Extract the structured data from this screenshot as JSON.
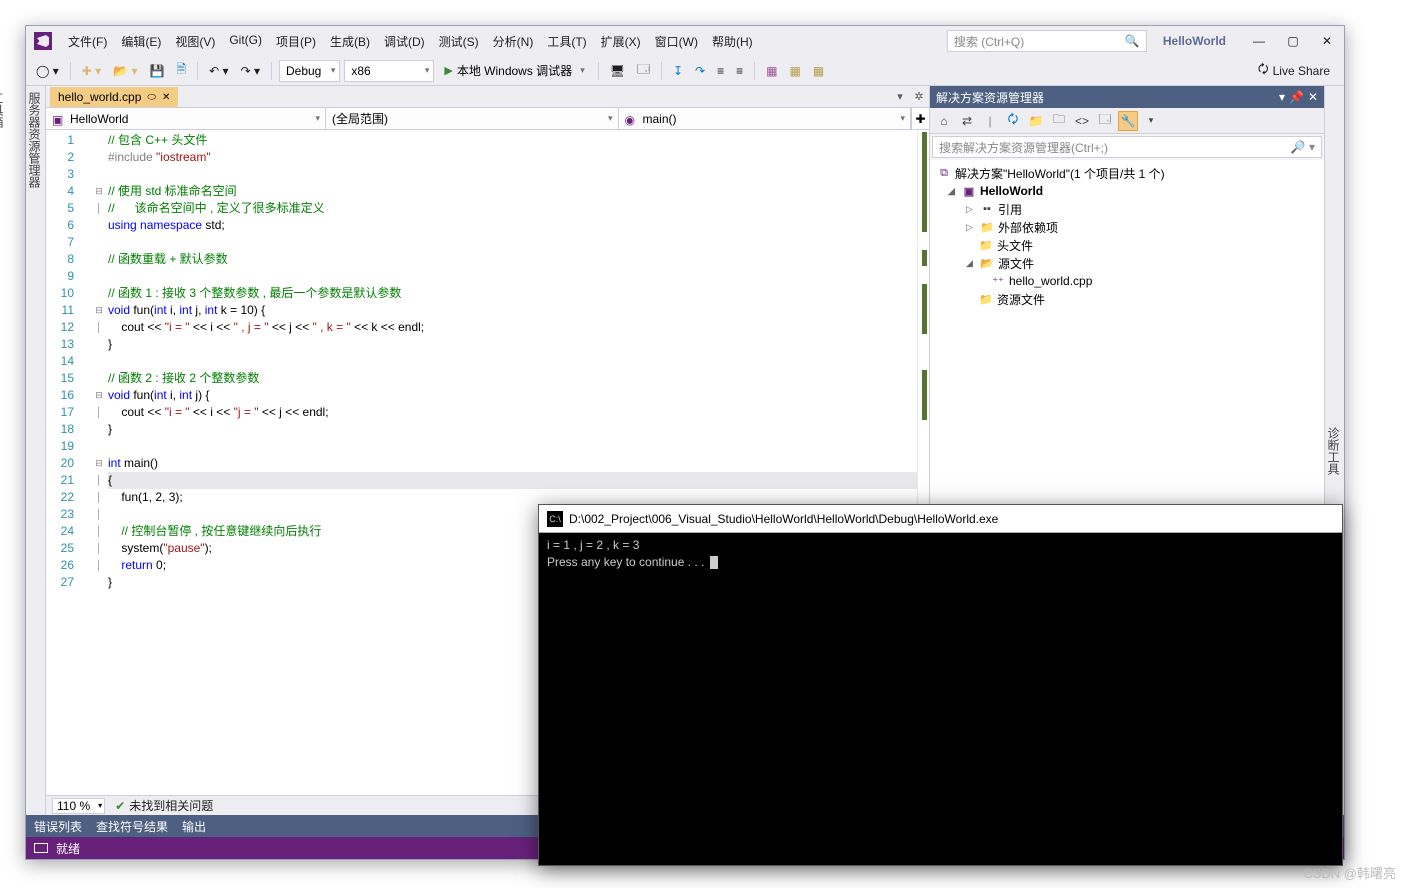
{
  "menu": [
    "文件(F)",
    "编辑(E)",
    "视图(V)",
    "Git(G)",
    "项目(P)",
    "生成(B)",
    "调试(D)",
    "测试(S)",
    "分析(N)",
    "工具(T)",
    "扩展(X)",
    "窗口(W)",
    "帮助(H)"
  ],
  "search_placeholder": "搜索 (Ctrl+Q)",
  "solution_name_titlebar": "HelloWorld",
  "toolbar": {
    "config": "Debug",
    "platform": "x86",
    "run_label": "本地 Windows 调试器",
    "live_share": "Live Share"
  },
  "side_tabs_left": [
    "服务器资源管理器",
    "工具箱"
  ],
  "side_tab_right": "诊断工具",
  "doc_tab": "hello_world.cpp",
  "nav": {
    "project": "HelloWorld",
    "scope": "(全局范围)",
    "member": "main()"
  },
  "code_lines": [
    {
      "n": 1,
      "fold": "",
      "html": "<span class='cm-comment'>// 包含 C++ 头文件</span>"
    },
    {
      "n": 2,
      "fold": "",
      "html": "<span class='cm-pre'>#include</span> <span class='cm-string'>\"iostream\"</span>"
    },
    {
      "n": 3,
      "fold": "",
      "html": ""
    },
    {
      "n": 4,
      "fold": "⊟",
      "html": "<span class='cm-comment'>// 使用 std 标准命名空间</span>"
    },
    {
      "n": 5,
      "fold": "│",
      "html": "<span class='cm-comment'>//      该命名空间中 , 定义了很多标准定义</span>"
    },
    {
      "n": 6,
      "fold": "",
      "html": "<span class='cm-keyword'>using namespace</span> std;"
    },
    {
      "n": 7,
      "fold": "",
      "html": ""
    },
    {
      "n": 8,
      "fold": "",
      "html": "<span class='cm-comment'>// 函数重载 + 默认参数</span>"
    },
    {
      "n": 9,
      "fold": "",
      "html": ""
    },
    {
      "n": 10,
      "fold": "",
      "html": "<span class='cm-comment'>// 函数 1 : 接收 3 个整数参数 , 最后一个参数是默认参数</span>"
    },
    {
      "n": 11,
      "fold": "⊟",
      "html": "<span class='cm-keyword'>void</span> fun(<span class='cm-keyword'>int</span> i, <span class='cm-keyword'>int</span> j, <span class='cm-keyword'>int</span> k = 10) {"
    },
    {
      "n": 12,
      "fold": "│",
      "html": "    cout &lt;&lt; <span class='cm-string'>\"i = \"</span> &lt;&lt; i &lt;&lt; <span class='cm-string'>\" , j = \"</span> &lt;&lt; j &lt;&lt; <span class='cm-string'>\" , k = \"</span> &lt;&lt; k &lt;&lt; endl;"
    },
    {
      "n": 13,
      "fold": "",
      "html": "}"
    },
    {
      "n": 14,
      "fold": "",
      "html": ""
    },
    {
      "n": 15,
      "fold": "",
      "html": "<span class='cm-comment'>// 函数 2 : 接收 2 个整数参数</span>"
    },
    {
      "n": 16,
      "fold": "⊟",
      "html": "<span class='cm-keyword'>void</span> fun(<span class='cm-keyword'>int</span> i, <span class='cm-keyword'>int</span> j) {"
    },
    {
      "n": 17,
      "fold": "│",
      "html": "    cout &lt;&lt; <span class='cm-string'>\"i = \"</span> &lt;&lt; i &lt;&lt; <span class='cm-string'>\"j = \"</span> &lt;&lt; j &lt;&lt; endl;"
    },
    {
      "n": 18,
      "fold": "",
      "html": "}"
    },
    {
      "n": 19,
      "fold": "",
      "html": ""
    },
    {
      "n": 20,
      "fold": "⊟",
      "html": "<span class='cm-keyword'>int</span> main()"
    },
    {
      "n": 21,
      "fold": "│",
      "hl": true,
      "html": "{"
    },
    {
      "n": 22,
      "fold": "│",
      "html": "    fun(1, 2, 3);"
    },
    {
      "n": 23,
      "fold": "│",
      "html": ""
    },
    {
      "n": 24,
      "fold": "│",
      "html": "    <span class='cm-comment'>// 控制台暂停 , 按任意键继续向后执行</span>"
    },
    {
      "n": 25,
      "fold": "│",
      "html": "    system(<span class='cm-string'>\"pause\"</span>);"
    },
    {
      "n": 26,
      "fold": "│",
      "html": "    <span class='cm-keyword'>return</span> 0;"
    },
    {
      "n": 27,
      "fold": "",
      "html": "}"
    }
  ],
  "zoom": "110 %",
  "issues_text": "未找到相关问题",
  "sln_panel": {
    "title": "解决方案资源管理器",
    "search_placeholder": "搜索解决方案资源管理器(Ctrl+;)",
    "root": "解决方案\"HelloWorld\"(1 个项目/共 1 个)",
    "project": "HelloWorld",
    "refs": "引用",
    "ext": "外部依赖项",
    "headers": "头文件",
    "sources": "源文件",
    "file": "hello_world.cpp",
    "res": "资源文件"
  },
  "bottom_tabs": [
    "错误列表",
    "查找符号结果",
    "输出"
  ],
  "status": "就绪",
  "console": {
    "title": "D:\\002_Project\\006_Visual_Studio\\HelloWorld\\HelloWorld\\Debug\\HelloWorld.exe",
    "line1": "i = 1 , j = 2 , k = 3",
    "line2": "Press any key to continue . . . "
  },
  "watermark": "CSDN @韩曙亮"
}
